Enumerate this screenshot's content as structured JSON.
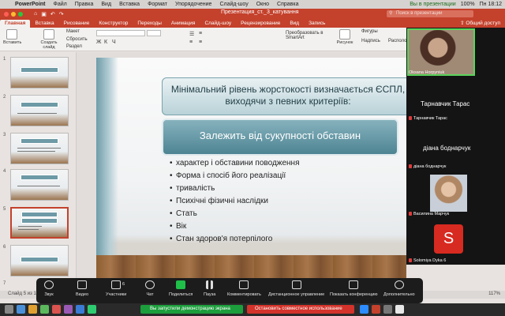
{
  "menubar": {
    "app": "PowerPoint",
    "items": [
      "Файл",
      "Правка",
      "Вид",
      "Вставка",
      "Формат",
      "Упорядочение",
      "Слайд-шоу",
      "Окно",
      "Справка"
    ],
    "zoom_indicator": "Вы в презентации",
    "battery": "100%",
    "clock": "Пн 18:12"
  },
  "window": {
    "title": "Презентация_ст._3_катування",
    "search_placeholder": "Поиск в презентации"
  },
  "ribbon_tabs": [
    "Главная",
    "Вставка",
    "Рисование",
    "Конструктор",
    "Переходы",
    "Анимация",
    "Слайд-шоу",
    "Рецензирование",
    "Вид",
    "Запись"
  ],
  "share_button": "Общий доступ",
  "ribbon": {
    "paste": "Вставить",
    "new_slide": "Создать слайд",
    "layout": "Макет",
    "reset": "Сбросить",
    "section": "Раздел",
    "shapes": "Фигуры",
    "convert_smartart": "Преобразовать в SmartArt",
    "picture": "Рисунок",
    "text_box": "Надпись",
    "arrange": "Располо"
  },
  "slides": {
    "numbers": [
      "1",
      "2",
      "3",
      "4",
      "5",
      "6",
      "7"
    ],
    "selected": 5
  },
  "slide": {
    "heading": "Мінімальний рівень жорстокості визначається ЄСПЛ, виходячи з певних критеріїв:",
    "subheading": "Залежить від сукупності обставин",
    "bullets": [
      "характер і обставини поводження",
      "Форма і спосіб його реалізації",
      "тривалість",
      "Психічні фізичні наслідки",
      "Стать",
      "Вік",
      "Стан здоров'я потерпілого"
    ]
  },
  "participants": [
    {
      "name": "Oksana Horpyniuk",
      "video": true
    },
    {
      "name": "Тарнавчик Тарас",
      "big_label": "Тарнавчик Тарас"
    },
    {
      "name": "діана боднарчук",
      "big_label": "діана боднарчук"
    },
    {
      "name": "Василина Марчук",
      "photo": true
    },
    {
      "name": "Solomiya Dyka 6",
      "initial": "S"
    }
  ],
  "status": {
    "slide_info": "Слайд 5 из 1",
    "zoom_level": "117%"
  },
  "zoom_toolbar": {
    "audio": "Звук",
    "video": "Видео",
    "participants": "Участники",
    "participants_count": "6",
    "chat": "Чат",
    "share": "Поделиться",
    "pause": "Пауза",
    "annotate": "Комментировать",
    "remote_control": "Дистанционное управление",
    "show_conference": "Показать конференцию",
    "more": "Дополнительно"
  },
  "notice": {
    "sharing": "Вы запустили демонстрацию экрана",
    "stop": "Остановить совместное использование"
  },
  "colors": {
    "accent": "#c4412c",
    "zoom_green": "#1c9e3c",
    "stop_red": "#d3332a",
    "slide_teal": "#4e8493"
  }
}
